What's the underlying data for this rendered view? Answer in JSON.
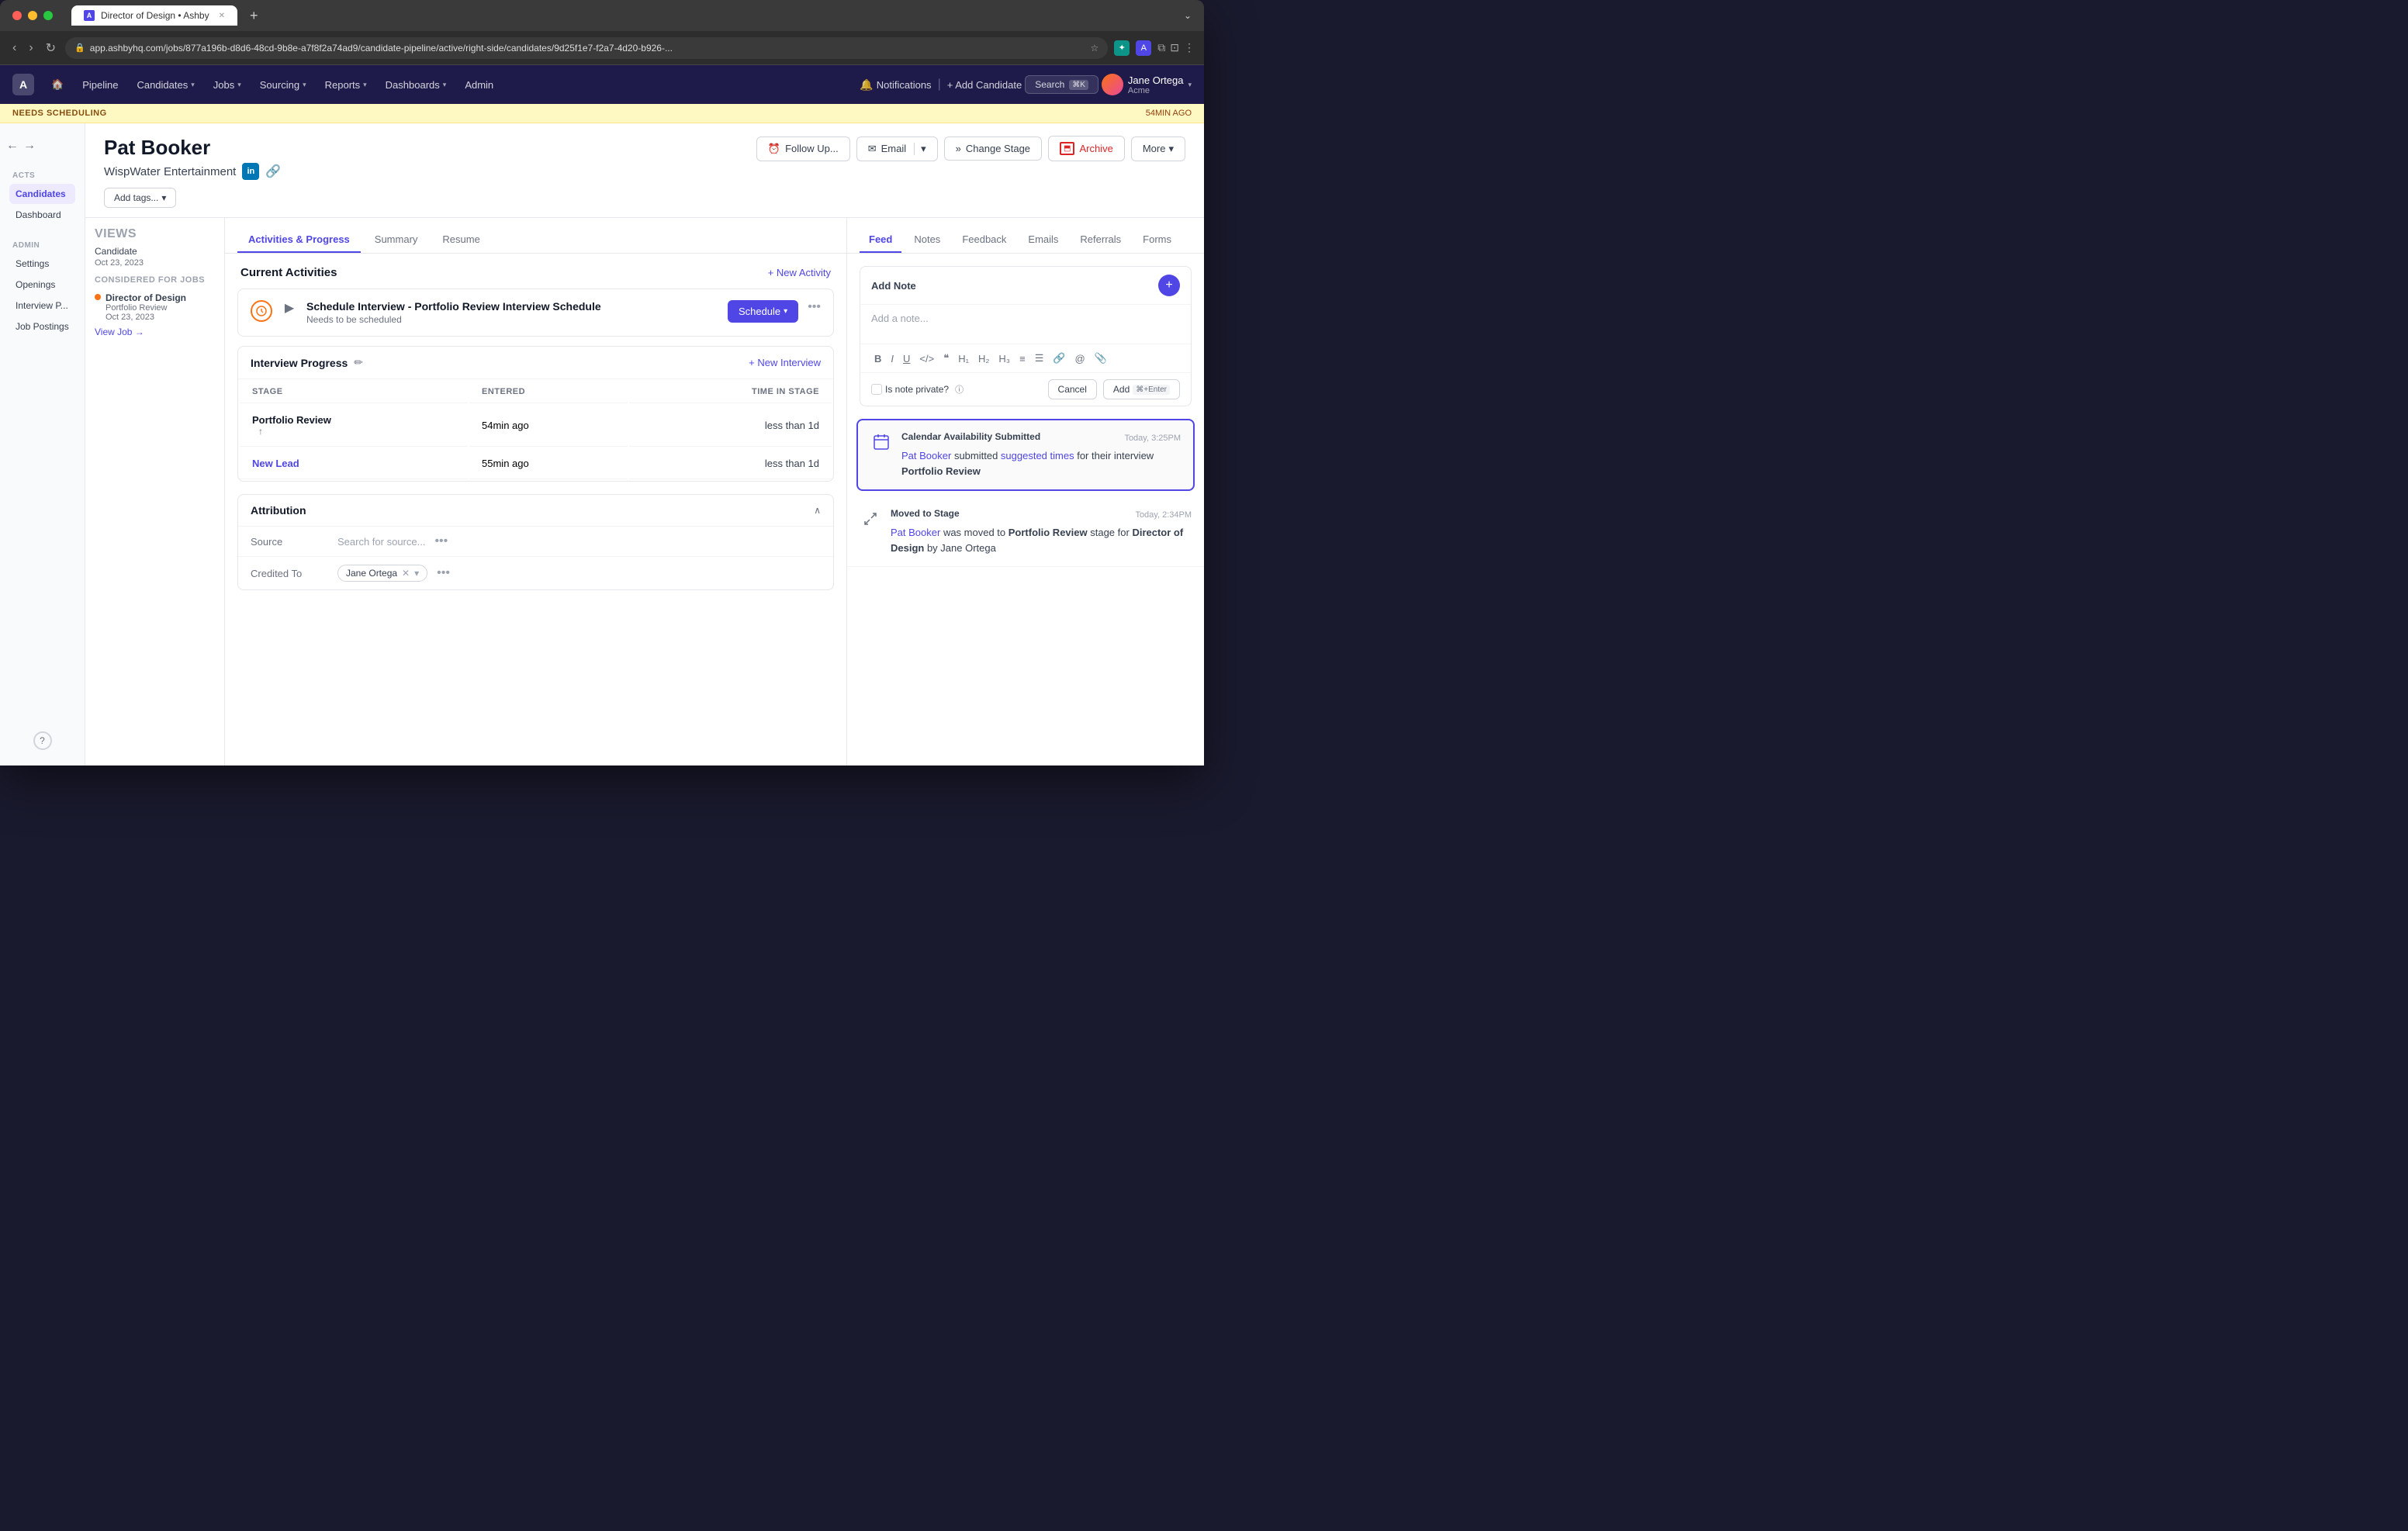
{
  "browser": {
    "tab_title": "Director of Design • Ashby",
    "address": "app.ashbyhq.com/jobs/877a196b-d8d6-48cd-9b8e-a7f8f2a74ad9/candidate-pipeline/active/right-side/candidates/9d25f1e7-f2a7-4d20-b926-...",
    "tab_plus": "+",
    "nav_back": "‹",
    "nav_forward": "›",
    "nav_refresh": "↻"
  },
  "topnav": {
    "logo": "A",
    "pipeline": "Pipeline",
    "candidates": "Candidates",
    "jobs": "Jobs",
    "sourcing": "Sourcing",
    "reports": "Reports",
    "dashboards": "Dashboards",
    "admin": "Admin",
    "notifications": "Notifications",
    "add_candidate": "+ Add Candidate",
    "search": "Search",
    "search_shortcut": "⌘K",
    "user_name": "Jane Ortega",
    "user_company": "Acme"
  },
  "notif_bar": {
    "status": "NEEDS SCHEDULING",
    "time_ago": "54MIN AGO"
  },
  "candidate": {
    "name": "Pat Booker",
    "company": "WispWater Entertainment",
    "btn_follow": "Follow Up...",
    "btn_email": "Email",
    "btn_change_stage": "Change Stage",
    "btn_archive": "Archive",
    "btn_more": "More",
    "tags_placeholder": "Add tags..."
  },
  "sidebar": {
    "views_label": "VIEWS",
    "views_item": "Candidate",
    "views_date": "Oct 23, 2023",
    "considered_label": "CONSIDERED FOR JOBS",
    "job_name": "Director of Design",
    "job_stage": "Portfolio Review",
    "job_date": "Oct 23, 2023",
    "view_job": "View Job →"
  },
  "left_tabs": {
    "activities": "Activities & Progress",
    "summary": "Summary",
    "resume": "Resume"
  },
  "activities": {
    "section_title": "Current Activities",
    "new_activity": "+ New Activity",
    "card_title": "Schedule Interview - Portfolio Review Interview Schedule",
    "card_subtitle": "Needs to be scheduled",
    "btn_schedule": "Schedule",
    "progress_title": "Interview Progress",
    "new_interview": "+ New Interview",
    "col_stage": "Stage",
    "col_entered": "Entered",
    "col_time": "Time in Stage",
    "stage1_name": "Portfolio Review",
    "stage1_entered": "54min ago",
    "stage1_time": "less than 1d",
    "stage2_name": "New Lead",
    "stage2_entered": "55min ago",
    "stage2_time": "less than 1d",
    "attribution_title": "Attribution",
    "source_label": "Source",
    "source_placeholder": "Search for source...",
    "credited_label": "Credited To",
    "credited_value": "Jane Ortega"
  },
  "feed": {
    "tab_feed": "Feed",
    "tab_notes": "Notes",
    "tab_feedback": "Feedback",
    "tab_emails": "Emails",
    "tab_referrals": "Referrals",
    "tab_forms": "Forms",
    "note_title": "Add Note",
    "note_placeholder": "Add a note...",
    "note_private_label": "Is note private?",
    "btn_cancel": "Cancel",
    "btn_add": "Add",
    "add_shortcut": "⌘+Enter",
    "entry1_title": "Calendar Availability Submitted",
    "entry1_time": "Today, 3:25PM",
    "entry1_name": "Pat Booker",
    "entry1_link": "suggested times",
    "entry1_text": " submitted ",
    "entry1_text2": " for their interview ",
    "entry1_item": "Portfolio Review",
    "entry2_title": "Moved to Stage",
    "entry2_time": "Today, 2:34PM",
    "entry2_name": "Pat Booker",
    "entry2_text": " was moved to ",
    "entry2_stage": "Portfolio Review",
    "entry2_text2": " stage for ",
    "entry2_job": "Director of Design",
    "entry2_text3": " by Jane Ortega"
  }
}
